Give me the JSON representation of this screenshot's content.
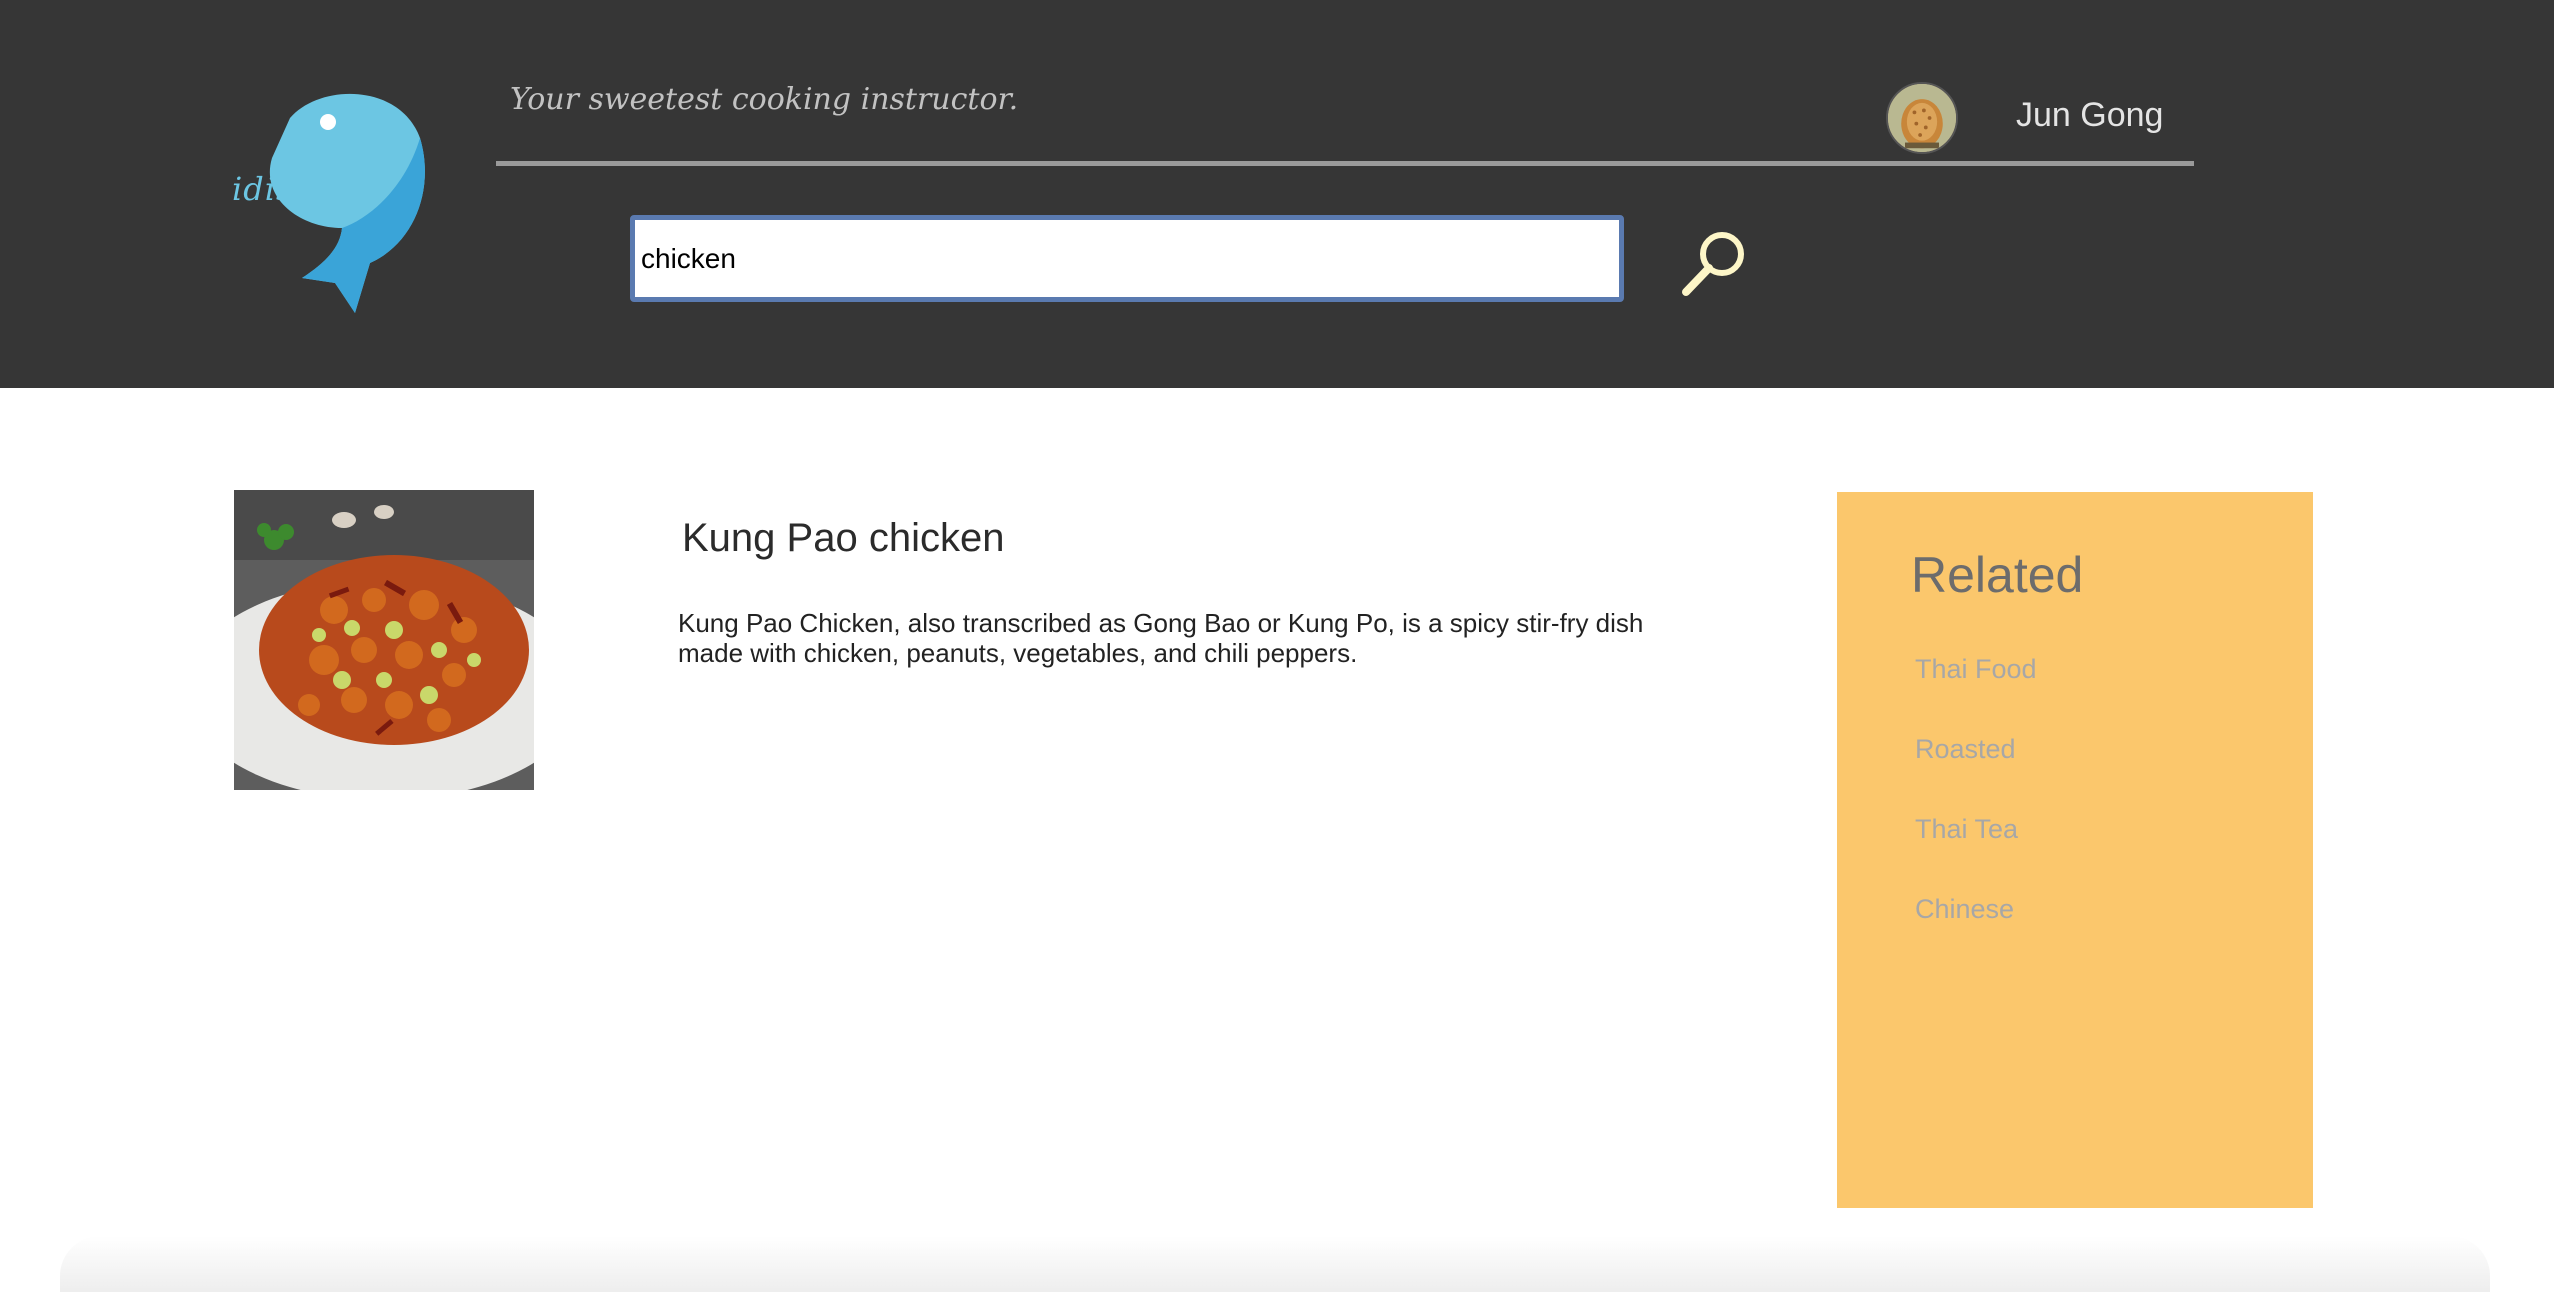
{
  "header": {
    "logo_text": "idish",
    "tagline": "Your sweetest cooking instructor.",
    "user_name": "Jun Gong"
  },
  "search": {
    "value": "chicken",
    "placeholder": ""
  },
  "result": {
    "title": "Kung Pao chicken",
    "description": "Kung Pao Chicken, also transcribed as Gong Bao or Kung Po, is a spicy stir-fry dish made with chicken, peanuts, vegetables, and chili peppers."
  },
  "related": {
    "heading": "Related",
    "items": [
      {
        "label": "Thai Food"
      },
      {
        "label": "Roasted"
      },
      {
        "label": "Thai Tea"
      },
      {
        "label": "Chinese"
      }
    ]
  },
  "colors": {
    "header_bg": "#363636",
    "brand_blue": "#6cc6e3",
    "related_bg": "#fbc76c",
    "search_border": "#5a7ab0",
    "search_icon": "#fdf6c8"
  },
  "icons": {
    "logo": "fish-logo-icon",
    "search": "search-icon",
    "avatar": "user-avatar-icon"
  }
}
